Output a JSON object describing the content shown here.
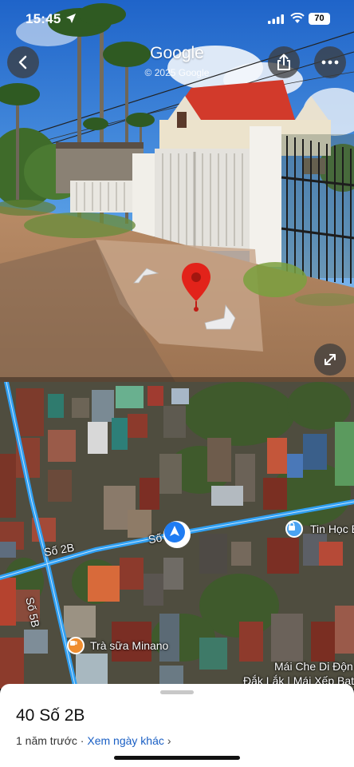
{
  "status_bar": {
    "time": "15:45",
    "battery": "70"
  },
  "street_view": {
    "watermark": "Google",
    "copyright": "© 2025 Google"
  },
  "map": {
    "labels": {
      "road_main": "Số 2B",
      "road_main_short": "Số",
      "road_side": "Số 5B",
      "poi_1": "Tin Học B",
      "poi_2": "Trà sữa Minano",
      "poi_3": "Mái Che Di Độn",
      "poi_4": "Đắk Lắk | Mái Xếp Bat"
    }
  },
  "sheet": {
    "title": "40 Số 2B",
    "date": "1 năm trước",
    "separator": " · ",
    "other_dates": "Xem ngày khác",
    "chevron": "›"
  },
  "icons": [
    "location-arrow-icon",
    "signal-icon",
    "wifi-icon",
    "back-icon",
    "share-icon",
    "more-icon",
    "expand-icon",
    "map-pin-icon",
    "lock-icon",
    "coffee-icon",
    "navigation-arrow-icon"
  ]
}
